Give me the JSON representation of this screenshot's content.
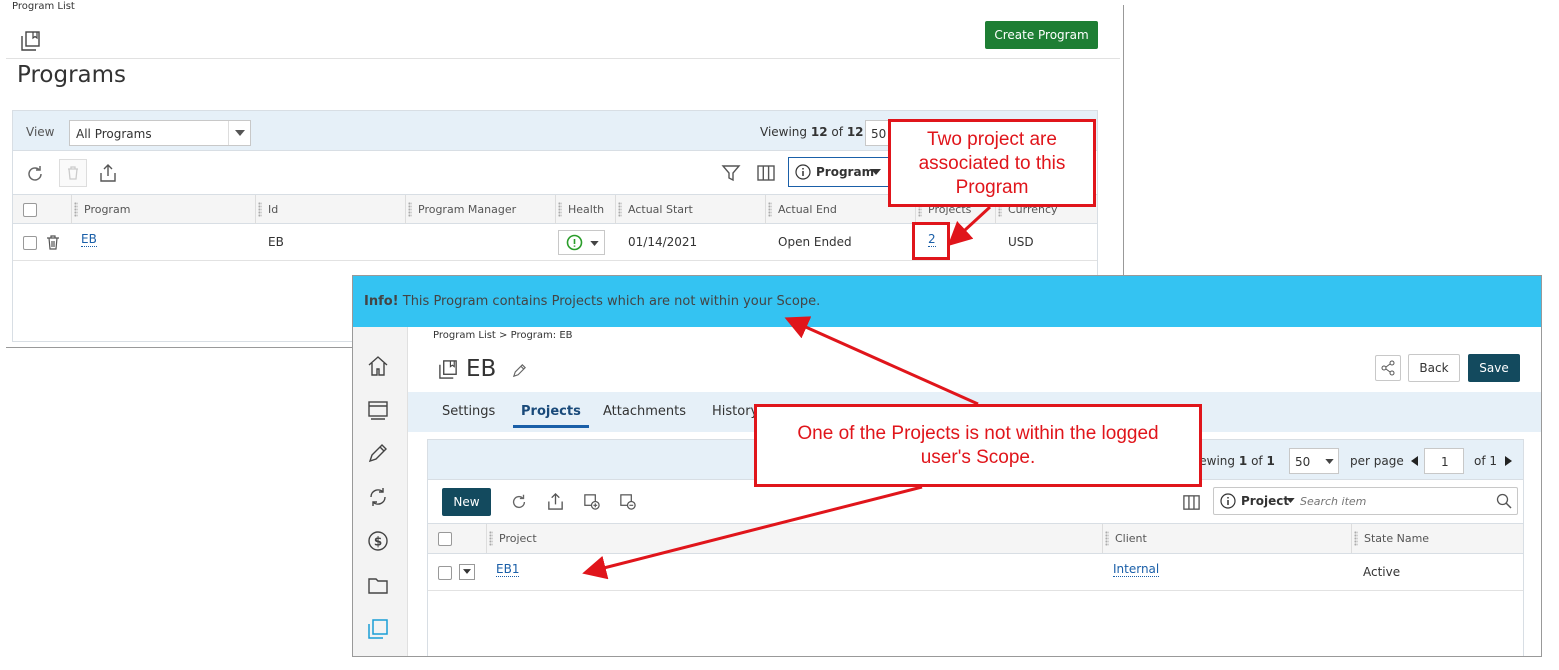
{
  "program_list": {
    "breadcrumb": "Program List",
    "title": "Programs",
    "create_button": "Create Program",
    "view_label": "View",
    "view_value": "All Programs",
    "viewing_prefix": "Viewing",
    "viewing_count": "12",
    "viewing_of": "of",
    "viewing_total": "12",
    "page_size": "50",
    "search_scope": "Program",
    "columns": [
      "Program",
      "Id",
      "Program Manager",
      "Health",
      "Actual Start",
      "Actual End",
      "Projects",
      "Currency"
    ],
    "row": {
      "program": "EB",
      "id": "EB",
      "program_manager": "",
      "actual_start": "01/14/2021",
      "actual_end": "Open Ended",
      "projects": "2",
      "currency": "USD"
    }
  },
  "program_detail": {
    "info_label": "Info!",
    "info_text": "This Program contains Projects which are not within your Scope.",
    "breadcrumb": "Program List > Program: EB",
    "title": "EB",
    "back_button": "Back",
    "save_button": "Save",
    "tabs": [
      "Settings",
      "Projects",
      "Attachments",
      "History"
    ],
    "active_tab": "Projects",
    "viewing_prefix": "Viewing",
    "viewing_count": "1",
    "viewing_of": "of",
    "viewing_total": "1",
    "page_size": "50",
    "per_page_label": "per page",
    "page_number": "1",
    "page_of": "of 1",
    "new_button": "New",
    "search_scope": "Project",
    "search_placeholder": "Search item",
    "columns": [
      "Project",
      "Client",
      "State Name"
    ],
    "row": {
      "project": "EB1",
      "client": "Internal",
      "state_name": "Active"
    }
  },
  "annotations": {
    "callout_projects": "Two project are associated to this Program",
    "callout_scope": "One of the Projects is not within the logged user's Scope."
  },
  "colors": {
    "annotation_red": "#e0151b",
    "info_banner": "#34c3f2",
    "create_button_green": "#1e7e34",
    "primary_dark": "#134a5e",
    "link_blue": "#1a5fa8",
    "health_green": "#2a9d2a"
  }
}
